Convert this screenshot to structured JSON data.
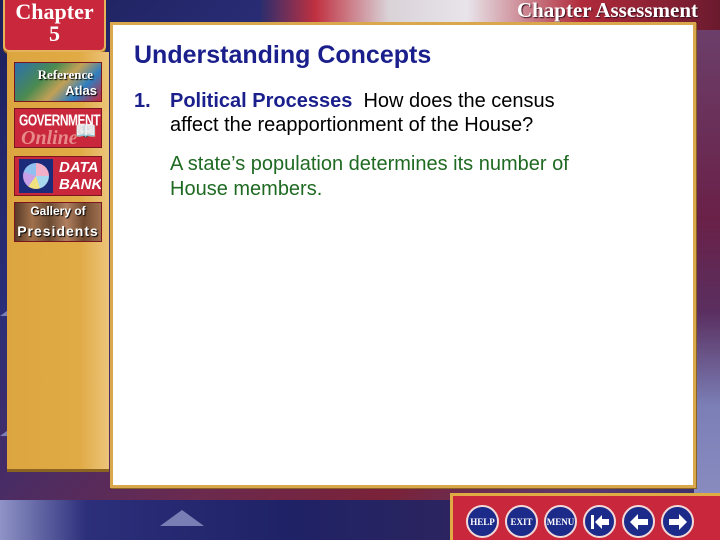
{
  "header": {
    "chapter_word": "Chapter",
    "chapter_number": "5",
    "section_title": "Chapter Assessment"
  },
  "sidebar": {
    "items": [
      {
        "id": "reference-atlas",
        "line1": "Reference",
        "line2": "Atlas"
      },
      {
        "id": "government-online",
        "line1": "GOVERNMENT",
        "line2": "Online"
      },
      {
        "id": "data-bank",
        "line1": "DATA",
        "line2": "BANK"
      },
      {
        "id": "gallery-of-presidents",
        "line1": "Gallery of",
        "line2": "Presidents"
      }
    ]
  },
  "main": {
    "title": "Understanding Concepts",
    "question": {
      "number": "1.",
      "topic": "Political Processes",
      "text_line1": "How does the census",
      "text_line2": "affect the reapportionment of the House?"
    },
    "answer": {
      "line1": "A state’s population determines its number of",
      "line2": "House members."
    }
  },
  "nav": {
    "help_label": "HELP",
    "exit_label": "EXIT",
    "menu_label": "MENU",
    "buttons": [
      "help",
      "exit",
      "menu",
      "first-slide",
      "previous",
      "next"
    ]
  },
  "colors": {
    "title_blue": "#1a1f8c",
    "answer_green": "#1f6a22",
    "accent_red": "#c8273c",
    "frame_gold": "#d9a84c",
    "nav_blue": "#1c2a8a"
  }
}
